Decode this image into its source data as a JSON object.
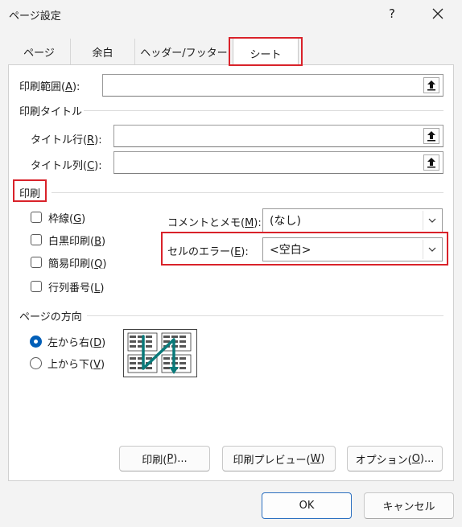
{
  "window": {
    "title": "ページ設定",
    "help": "?"
  },
  "tabs": [
    {
      "label": "ページ"
    },
    {
      "label": "余白"
    },
    {
      "label": "ヘッダー/フッター"
    },
    {
      "label": "シート"
    }
  ],
  "print_area": {
    "label_pre": "印刷範囲(",
    "key": "A",
    "label_post": "):",
    "value": ""
  },
  "print_titles": {
    "heading": "印刷タイトル",
    "rows": {
      "label_pre": "タイトル行(",
      "key": "R",
      "label_post": "):",
      "value": ""
    },
    "cols": {
      "label_pre": "タイトル列(",
      "key": "C",
      "label_post": "):",
      "value": ""
    }
  },
  "print": {
    "heading": "印刷",
    "options": [
      {
        "pre": "枠線(",
        "key": "G",
        "post": ")",
        "checked": false
      },
      {
        "pre": "白黒印刷(",
        "key": "B",
        "post": ")",
        "checked": false
      },
      {
        "pre": "簡易印刷(",
        "key": "Q",
        "post": ")",
        "checked": false
      },
      {
        "pre": "行列番号(",
        "key": "L",
        "post": ")",
        "checked": false
      }
    ],
    "comments": {
      "label_pre": "コメントとメモ(",
      "key": "M",
      "label_post": "):",
      "value": "(なし)"
    },
    "cell_errors": {
      "label_pre": "セルのエラー(",
      "key": "E",
      "label_post": "):",
      "value": "<空白>"
    }
  },
  "page_order": {
    "heading": "ページの方向",
    "options": [
      {
        "pre": "左から右(",
        "key": "D",
        "post": ")",
        "selected": true
      },
      {
        "pre": "上から下(",
        "key": "V",
        "post": ")",
        "selected": false
      }
    ]
  },
  "buttons": {
    "print": {
      "pre": "印刷(",
      "key": "P",
      "post": ")..."
    },
    "preview": {
      "pre": "印刷プレビュー(",
      "key": "W",
      "post": ")"
    },
    "options": {
      "pre": "オプション(",
      "key": "O",
      "post": ")..."
    },
    "ok": "OK",
    "cancel": "キャンセル"
  },
  "colors": {
    "highlight": "#d9222a",
    "accent": "#005fb8",
    "teal_arrow": "#0a7a7a"
  },
  "icons": {
    "collapse": "collapse-dialog-icon",
    "dropdown": "chevron-down-icon",
    "close": "close-icon"
  }
}
